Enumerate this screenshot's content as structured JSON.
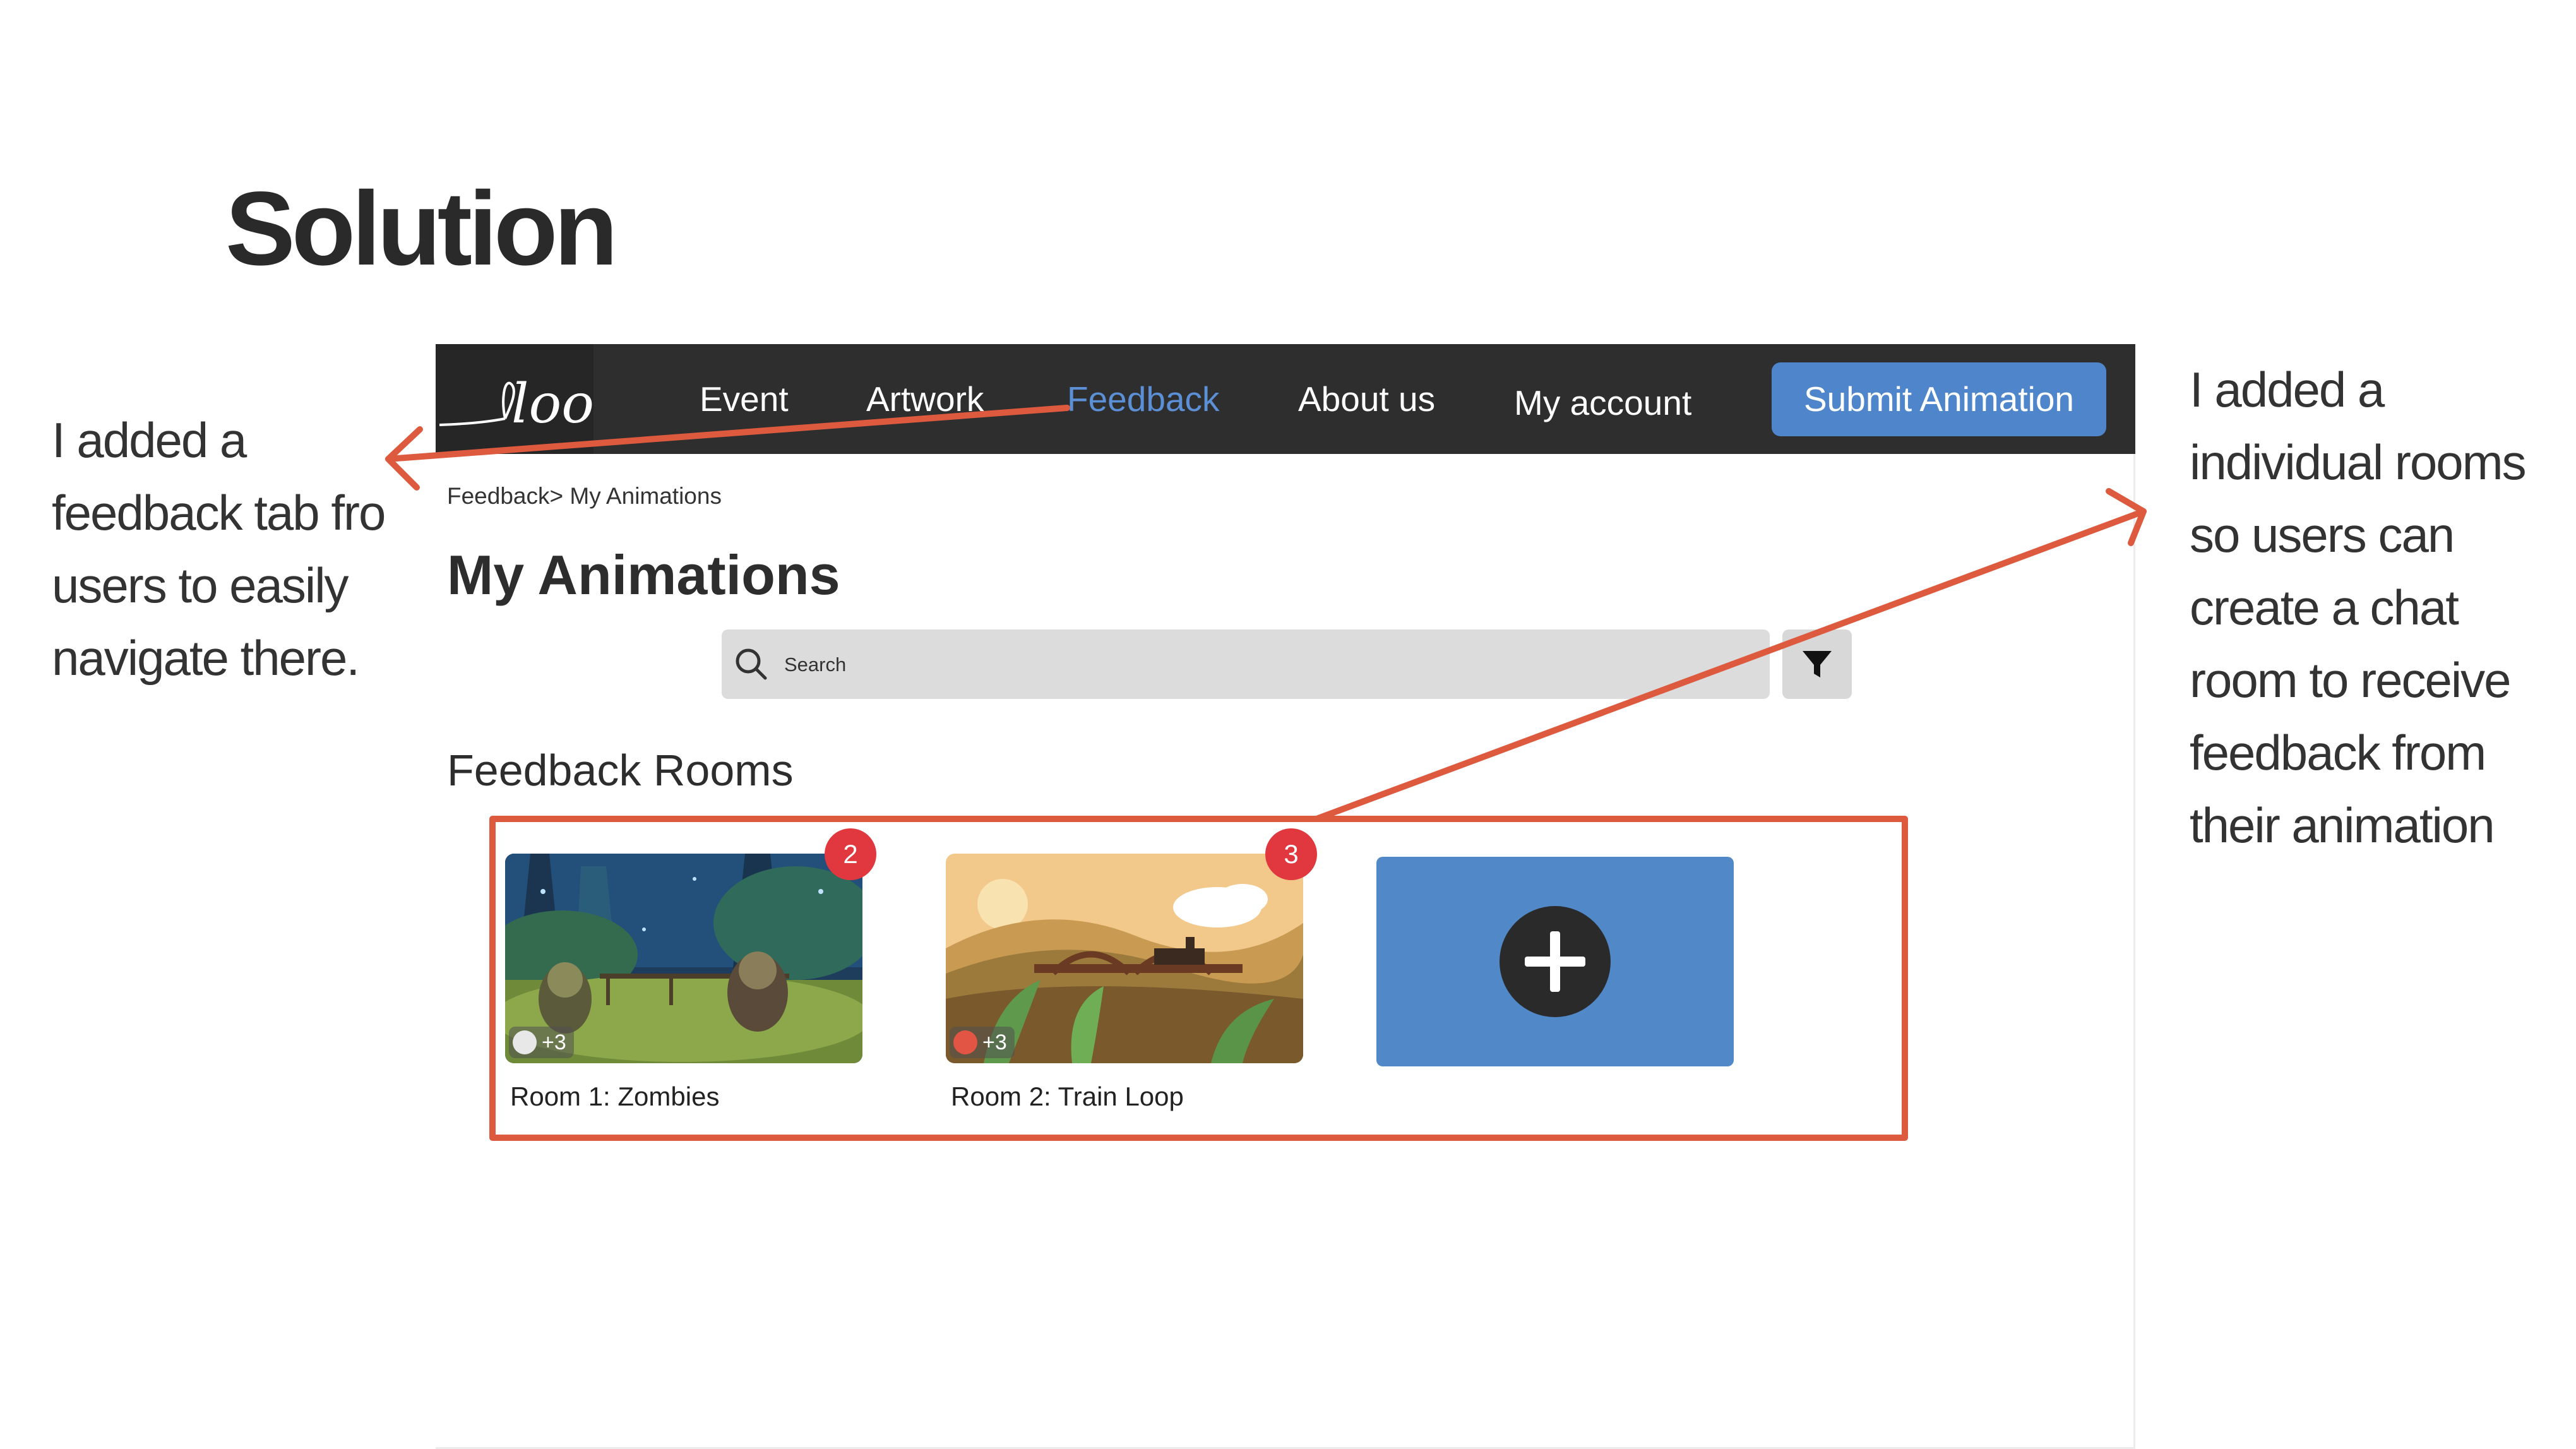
{
  "slide": {
    "title": "Solution",
    "note_left": "I added a feedback tab fro users to easily navigate there.",
    "note_right": "I added a individual rooms so users can create a chat room to receive feedback from their animation"
  },
  "app": {
    "logo_text": "loop",
    "nav": {
      "items": [
        "Event",
        "Artwork",
        "Feedback",
        "About us",
        "My account"
      ],
      "active": "Feedback",
      "submit_label": "Submit Animation"
    },
    "breadcrumb": "Feedback> My Animations",
    "page_title": "My Animations",
    "search": {
      "placeholder": "Search"
    },
    "section_title": "Feedback Rooms",
    "rooms": [
      {
        "label": "Room 1: Zombies",
        "badge": "2",
        "members": "+3"
      },
      {
        "label": "Room 2: Train Loop",
        "badge": "3",
        "members": "+3"
      }
    ]
  },
  "icons": {
    "search": "search-icon",
    "filter": "filter-icon",
    "add": "plus-circle-icon"
  },
  "colors": {
    "nav_bg": "#2e2e2e",
    "accent": "#4f86cb",
    "active_nav": "#5b8fd6",
    "badge": "#e0383e",
    "annotation": "#dd5a3f"
  }
}
